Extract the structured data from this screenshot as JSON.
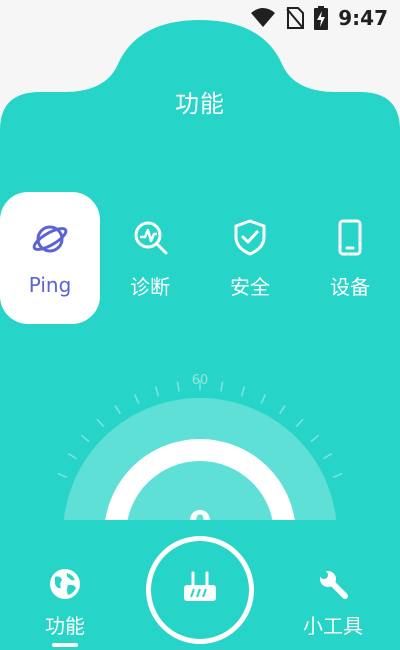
{
  "status_bar": {
    "time": "9:47",
    "icons": [
      "wifi-icon",
      "no-sim-icon",
      "battery-charging-icon"
    ]
  },
  "header": {
    "title": "功能"
  },
  "tabs": [
    {
      "label": "Ping",
      "icon": "planet-icon",
      "active": true
    },
    {
      "label": "诊断",
      "icon": "diagnosis-icon",
      "active": false
    },
    {
      "label": "安全",
      "icon": "shield-check-icon",
      "active": false
    },
    {
      "label": "设备",
      "icon": "phone-device-icon",
      "active": false
    }
  ],
  "gauge": {
    "max_label": "60",
    "value": "0"
  },
  "bottom_nav": {
    "left": {
      "label": "功能",
      "icon": "globe-icon",
      "active": true
    },
    "center": {
      "icon": "router-icon"
    },
    "right": {
      "label": "小工具",
      "icon": "wrench-icon",
      "active": false
    }
  },
  "colors": {
    "accent": "#27d4c8",
    "active_text": "#5b63d6",
    "background": "#f6f6f6"
  }
}
